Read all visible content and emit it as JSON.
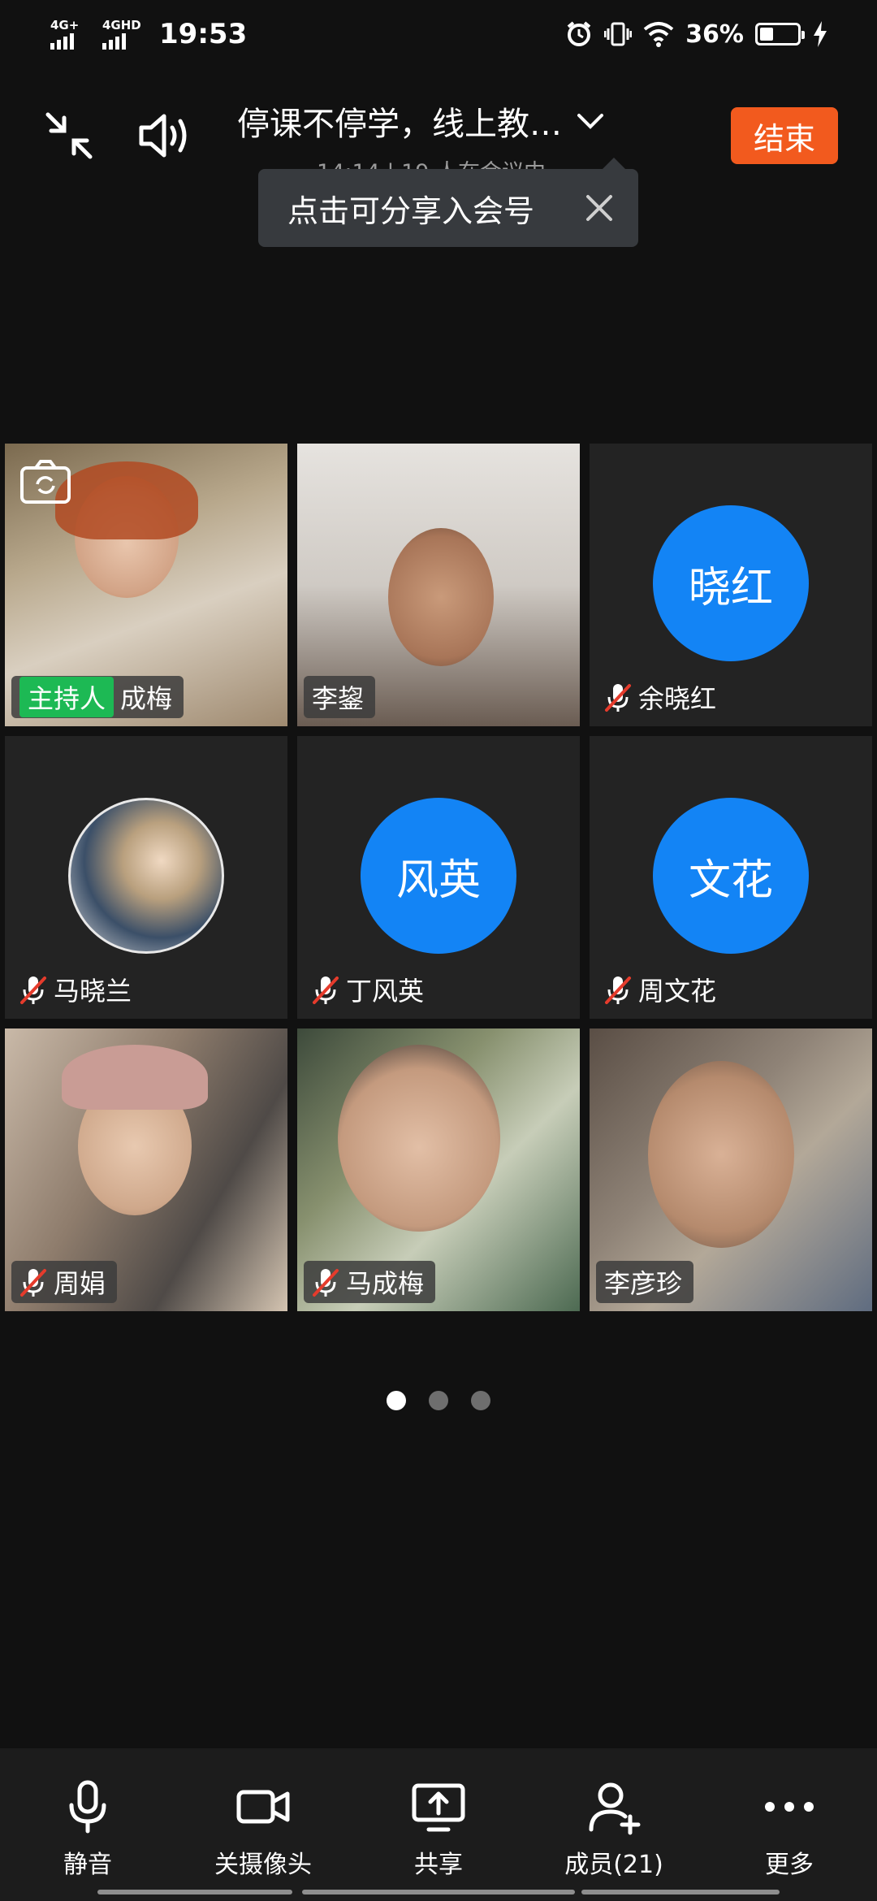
{
  "status_bar": {
    "net1": "4G+",
    "net2": "4GHD",
    "time": "19:53",
    "battery": "36%",
    "battery_level": 0.36
  },
  "header": {
    "title": "停课不停学，线上教…",
    "subtitle": "14:14 | 19 人在会议中",
    "end_label": "结束"
  },
  "tooltip": {
    "text": "点击可分享入会号"
  },
  "participants": [
    {
      "name": "成梅",
      "host_label": "主持人",
      "muted": false,
      "kind": "video"
    },
    {
      "name": "李鋆",
      "muted": false,
      "kind": "video"
    },
    {
      "name": "余晓红",
      "avatar": "晓红",
      "muted": true,
      "kind": "avatar"
    },
    {
      "name": "马晓兰",
      "muted": true,
      "kind": "photo"
    },
    {
      "name": "丁风英",
      "avatar": "风英",
      "muted": true,
      "kind": "avatar"
    },
    {
      "name": "周文花",
      "avatar": "文花",
      "muted": true,
      "kind": "avatar"
    },
    {
      "name": "周娟",
      "muted": true,
      "kind": "video"
    },
    {
      "name": "马成梅",
      "muted": true,
      "kind": "video"
    },
    {
      "name": "李彦珍",
      "muted": false,
      "kind": "video"
    }
  ],
  "pager": {
    "pages": 3,
    "current": 1
  },
  "toolbar": {
    "mute": "静音",
    "camera_off": "关摄像头",
    "share": "共享",
    "members": "成员(21)",
    "more": "更多"
  },
  "colors": {
    "end_button": "#f25a1e",
    "avatar_blue": "#1384f5",
    "host_badge": "#1db954"
  }
}
